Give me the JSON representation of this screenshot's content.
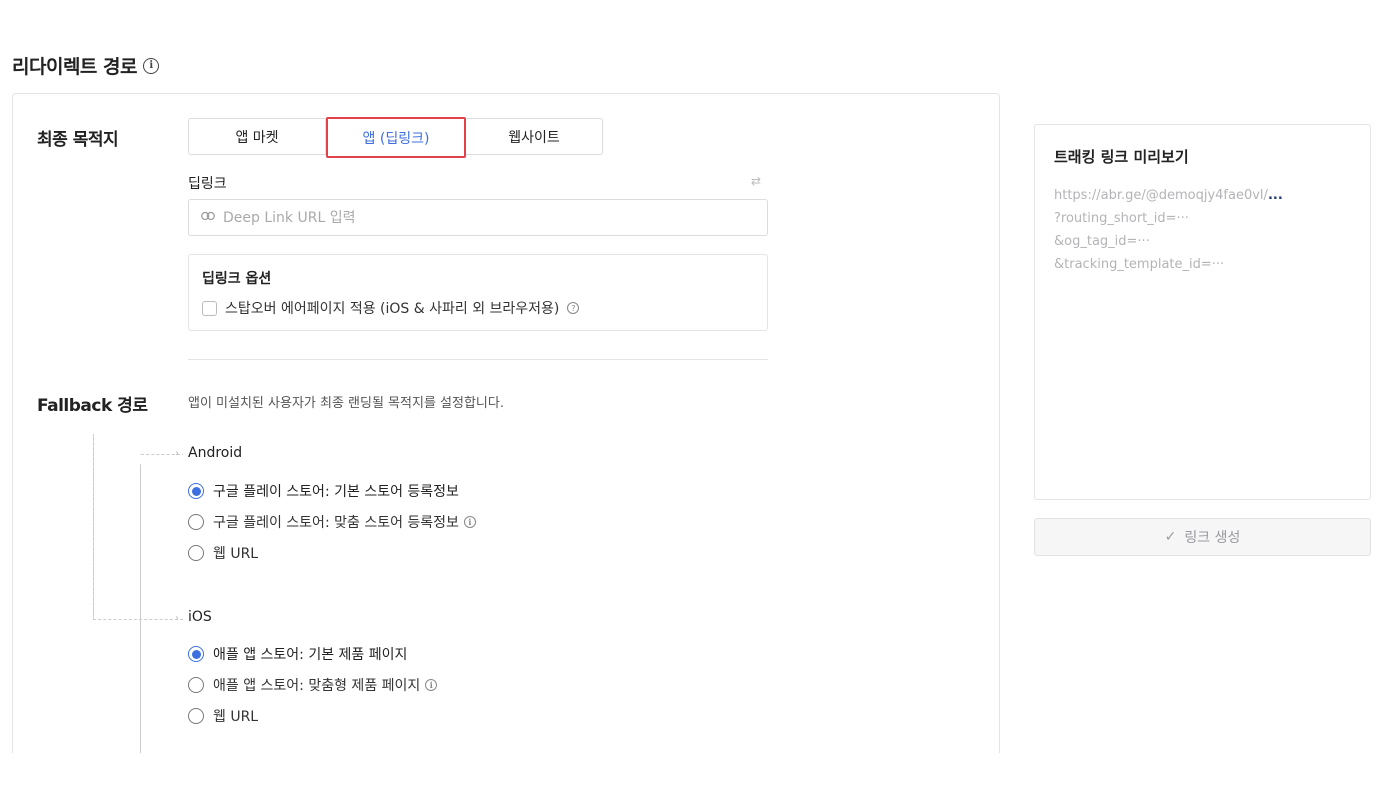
{
  "section": {
    "title": "리다이렉트 경로",
    "info_icon": "info-icon"
  },
  "destination": {
    "label": "최종 목적지",
    "tabs": [
      {
        "label": "앱 마켓",
        "active": false
      },
      {
        "label": "앱 (딥링크)",
        "active": true
      },
      {
        "label": "웹사이트",
        "active": false
      }
    ],
    "active_color": "#3d6fe0",
    "highlight_color": "#e0414a"
  },
  "deeplink": {
    "label": "딥링크",
    "placeholder": "Deep Link URL 입력",
    "value": "",
    "link_icon": "link-icon",
    "swap_icon": "swap-icon",
    "options": {
      "title": "딥링크 옵션",
      "checkbox_label": "스탑오버 에어페이지 적용 (iOS & 사파리 외 브라우저용)",
      "checked": false,
      "help_icon": "question-icon"
    }
  },
  "fallback": {
    "label": "Fallback 경로",
    "description": "앱이 미설치된 사용자가 최종 랜딩될 목적지를 설정합니다.",
    "android": {
      "label": "Android",
      "options": [
        {
          "label": "구글 플레이 스토어: 기본 스토어 등록정보",
          "checked": true,
          "info": false
        },
        {
          "label": "구글 플레이 스토어: 맞춤 스토어 등록정보",
          "checked": false,
          "info": true
        },
        {
          "label": "웹 URL",
          "checked": false,
          "info": false
        }
      ]
    },
    "ios": {
      "label": "iOS",
      "options": [
        {
          "label": "애플 앱 스토어: 기본 제품 페이지",
          "checked": true,
          "info": false
        },
        {
          "label": "애플 앱 스토어: 맞춤형 제품 페이지",
          "checked": false,
          "info": true
        },
        {
          "label": "웹 URL",
          "checked": false,
          "info": false
        }
      ]
    }
  },
  "preview": {
    "title": "트래킹 링크 미리보기",
    "url_base": "https://abr.ge/@demoqjy4fae0vl/",
    "url_ellipsis": "...",
    "params": [
      "?routing_short_id=···",
      "&og_tag_id=···",
      "&tracking_template_id=···"
    ]
  },
  "create_button": {
    "label": "링크 생성",
    "icon": "check-icon"
  }
}
